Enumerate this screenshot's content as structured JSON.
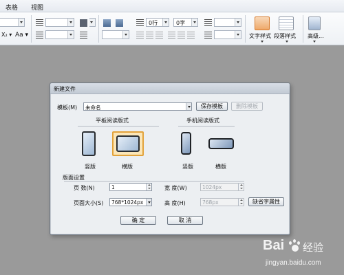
{
  "menubar": {
    "items": [
      "表格",
      "视图"
    ]
  },
  "ribbon": {
    "para_before": "0行",
    "para_after": "0字",
    "text_style_label": "文字样式",
    "para_style_label": "段落样式",
    "advanced_label": "高级...",
    "icons": [
      "indent-icon",
      "line-spacing-icon",
      "shading-icon",
      "align-icons",
      "text-style-icon",
      "paragraph-style-icon",
      "advanced-icon"
    ]
  },
  "dialog": {
    "title": "新建文件",
    "template_label": "模板(M)",
    "template_value": "未命名",
    "save_template": "保存模板",
    "delete_template": "删除模板",
    "tablet_group": "平板阅读版式",
    "phone_group": "手机阅读版式",
    "tablet_portrait": "竖版",
    "tablet_landscape": "横版",
    "phone_portrait": "竖版",
    "phone_landscape": "横版",
    "page_setup": "版面设置",
    "pages_label": "页    数(N)",
    "pages_value": "1",
    "width_label": "宽    度(W)",
    "width_value": "1024px",
    "page_size_label": "页面大小(S)",
    "page_size_value": "768*1024px",
    "height_label": "高    度(H)",
    "height_value": "768px",
    "default_font": "缺省字属性",
    "ok": "确  定",
    "cancel": "取  消"
  },
  "watermark": {
    "brand": "Bai",
    "brand2": "经验",
    "url": "jingyan.baidu.com"
  },
  "colors": {
    "selected_tile": "#fbe6b8",
    "selected_border": "#e2a23a",
    "background": "#9a9a9a"
  }
}
